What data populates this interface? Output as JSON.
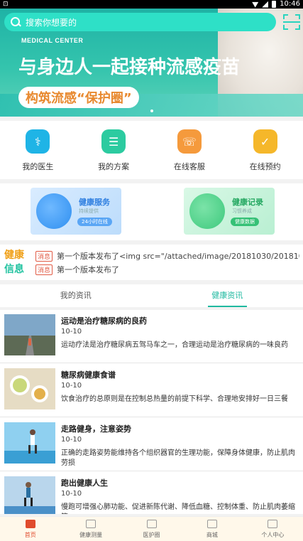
{
  "status_bar": {
    "time": "10:46"
  },
  "search": {
    "placeholder": "搜索你想要的"
  },
  "banner": {
    "brand": "MEDICAL CENTER",
    "headline": "与身边人一起接种流感疫苗",
    "subline": "构筑流感“保护圈”"
  },
  "quick_actions": [
    {
      "label": "我的医生",
      "icon": "doctor-icon",
      "color": "#1fb4e6"
    },
    {
      "label": "我的方案",
      "icon": "plan-icon",
      "color": "#2ccba0"
    },
    {
      "label": "在线客服",
      "icon": "chat-icon",
      "color": "#f59a3c"
    },
    {
      "label": "在线预约",
      "icon": "appointment-icon",
      "color": "#f5b72a"
    }
  ],
  "service_cards": [
    {
      "title": "健康服务",
      "subtitle": "持续提供",
      "pill": "24小时在线"
    },
    {
      "title": "健康记录",
      "subtitle": "习惯养成",
      "pill": "健康数据"
    }
  ],
  "news_strip": {
    "logo_top": "健康",
    "logo_bottom": "信息",
    "items": [
      {
        "tag": "消息",
        "text": "第一个版本发布了<img src=\"/attached/image/20181030/201810..."
      },
      {
        "tag": "消息",
        "text": "第一个版本发布了"
      }
    ]
  },
  "tabs": [
    {
      "label": "我的资讯",
      "active": false
    },
    {
      "label": "健康资讯",
      "active": true
    }
  ],
  "articles": [
    {
      "title": "运动是治疗糖尿病的良药",
      "date": "10-10",
      "desc": "运动疗法是治疗糖尿病五驾马车之一，合理运动是治疗糖尿病的一味良药"
    },
    {
      "title": "糖尿病健康食谱",
      "date": "10-10",
      "desc": "饮食治疗的总原则是在控制总热量的前提下科学、合理地安排好一日三餐"
    },
    {
      "title": "走路健身，注意姿势",
      "date": "10-10",
      "desc": "正确的走路姿势能维持各个组织器官的生理功能，保障身体健康，防止肌肉劳损"
    },
    {
      "title": "跑出健康人生",
      "date": "10-10",
      "desc": "慢跑可增强心肺功能、促进新陈代谢、降低血糖、控制体重、防止肌肉萎缩等"
    }
  ],
  "bottom_nav": [
    {
      "label": "首页",
      "active": true
    },
    {
      "label": "健康测量",
      "active": false
    },
    {
      "label": "医护圈",
      "active": false
    },
    {
      "label": "商城",
      "active": false
    },
    {
      "label": "个人中心",
      "active": false
    }
  ]
}
